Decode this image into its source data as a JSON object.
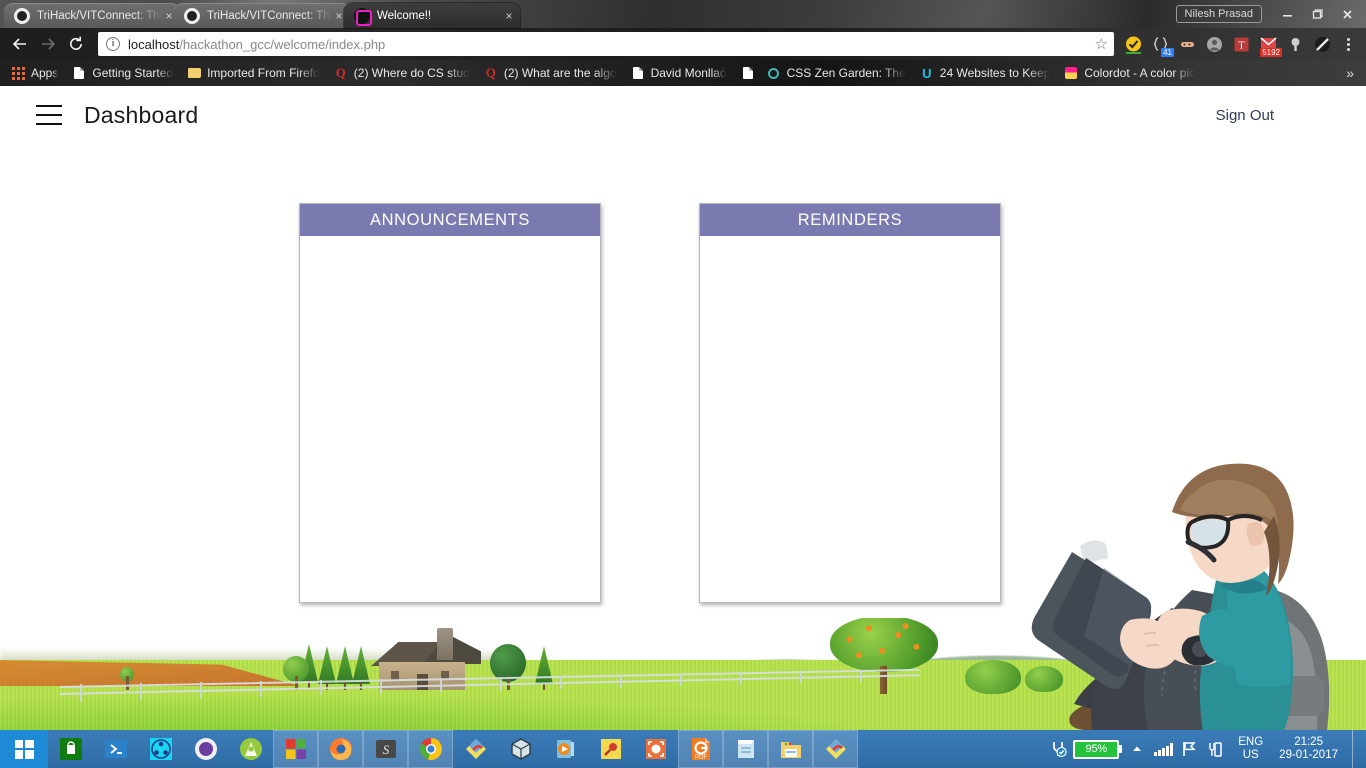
{
  "browser": {
    "profile_name": "Nilesh Prasad",
    "window_controls": {
      "minimize": "minimize-button",
      "maximize": "maximize-button",
      "close": "close-button"
    },
    "tabs": [
      {
        "title": "TriHack/VITConnect: This",
        "favicon": "github-icon",
        "active": false,
        "close": "×"
      },
      {
        "title": "TriHack/VITConnect: This",
        "favicon": "github-icon",
        "active": false,
        "close": "×"
      },
      {
        "title": "Welcome!!",
        "favicon": "site-icon",
        "active": true,
        "close": "×"
      }
    ],
    "toolbar": {
      "back": "←",
      "forward": "→",
      "reload": "↻",
      "url_host": "localhost",
      "url_path": "/hackathon_gcc/welcome/index.php",
      "url_full": "localhost/hackathon_gcc/welcome/index.php",
      "info_icon": "i",
      "bookmark_star": "☆",
      "extensions": [
        {
          "name": "adblock-extension",
          "badge": "",
          "badge_color": ""
        },
        {
          "name": "code-extension",
          "badge": "41",
          "badge_color": "#2d7ff9"
        },
        {
          "name": "capsule-extension",
          "badge": "",
          "badge_color": ""
        },
        {
          "name": "user-extension",
          "badge": "",
          "badge_color": ""
        },
        {
          "name": "translate-extension",
          "badge": "",
          "badge_color": ""
        },
        {
          "name": "mail-extension",
          "badge": "5192",
          "badge_color": "#d93025"
        },
        {
          "name": "key-extension",
          "badge": "",
          "badge_color": ""
        },
        {
          "name": "theme-extension",
          "badge": "",
          "badge_color": ""
        }
      ],
      "menu": "chrome-menu"
    },
    "bookmarks": [
      {
        "label": "Apps",
        "icon": "apps-grid-icon"
      },
      {
        "label": "Getting Started",
        "icon": "page-icon"
      },
      {
        "label": "Imported From Firefo",
        "icon": "folder-icon"
      },
      {
        "label": "(2) Where do CS stud",
        "icon": "quora-icon"
      },
      {
        "label": "(2) What are the algo",
        "icon": "quora-icon"
      },
      {
        "label": "David Monllaó",
        "icon": "page-icon"
      },
      {
        "label": "",
        "icon": "page-icon"
      },
      {
        "label": "CSS Zen Garden: The",
        "icon": "ring-icon"
      },
      {
        "label": "24 Websites to Keep",
        "icon": "u-icon"
      },
      {
        "label": "Colordot - A color pic",
        "icon": "colordot-icon"
      }
    ],
    "bookmarks_overflow": "»"
  },
  "page": {
    "header": {
      "menu_icon": "hamburger-menu-icon",
      "title": "Dashboard",
      "sign_out": "Sign Out"
    },
    "cards": [
      {
        "title": "ANNOUNCEMENTS",
        "body": ""
      },
      {
        "title": "REMINDERS",
        "body": ""
      }
    ],
    "colors": {
      "card_header": "#7b7ab0",
      "title_text": "#1a1a1a",
      "sign_out_text": "#2d3b55"
    },
    "illustration": "student-reading-book-illustration",
    "background": "green-meadow-landscape-with-house-and-trees"
  },
  "taskbar": {
    "start": "windows-start-button",
    "apps": [
      {
        "name": "microsoft-store",
        "open": false
      },
      {
        "name": "powershell",
        "open": false
      },
      {
        "name": "network-share",
        "open": false
      },
      {
        "name": "cortana-circle",
        "open": false
      },
      {
        "name": "android-studio",
        "open": false
      },
      {
        "name": "microsoft-office",
        "open": true
      },
      {
        "name": "firefox",
        "open": true
      },
      {
        "name": "sublime-text",
        "open": true
      },
      {
        "name": "google-chrome",
        "open": true
      },
      {
        "name": "paint-diamond",
        "open": false
      },
      {
        "name": "virtualbox",
        "open": false
      },
      {
        "name": "media-player",
        "open": false
      },
      {
        "name": "sticky-notes",
        "open": false
      },
      {
        "name": "screenshot-tool",
        "open": false
      },
      {
        "name": "pdf-converter",
        "open": true
      },
      {
        "name": "notepad",
        "open": true
      },
      {
        "name": "file-explorer",
        "open": true
      },
      {
        "name": "paint-diamond-2",
        "open": true
      }
    ],
    "tray": {
      "power_icon": "power-plug-icon",
      "battery_percent": "95%",
      "show_hidden": "▲",
      "network_icon": "signal-bars-icon",
      "flag_icon": "flag-icon",
      "device_icon": "device-icon",
      "language_line1": "ENG",
      "language_line2": "US",
      "time": "21:25",
      "date": "29-01-2017"
    }
  }
}
